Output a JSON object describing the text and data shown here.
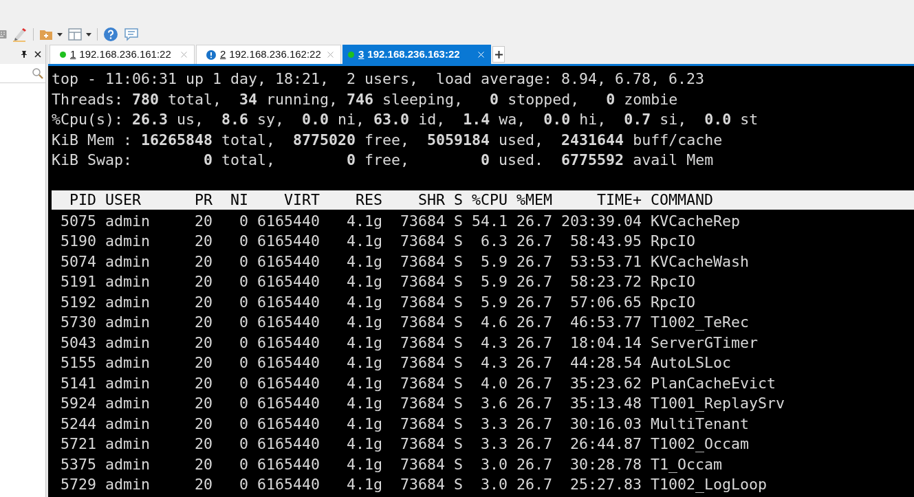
{
  "toolbar": {
    "items": [
      {
        "kind": "keyboard"
      },
      {
        "kind": "pen"
      },
      {
        "kind": "separator"
      },
      {
        "kind": "folder-add",
        "dropdown": true
      },
      {
        "kind": "layout",
        "dropdown": true
      },
      {
        "kind": "separator"
      },
      {
        "kind": "help"
      },
      {
        "kind": "chat"
      }
    ]
  },
  "tabs": [
    {
      "number": "1",
      "label": "192.168.236.161:22",
      "kind": "connected",
      "selected": false
    },
    {
      "number": "2",
      "label": "192.168.236.162:22",
      "kind": "warning",
      "selected": false
    },
    {
      "number": "3",
      "label": "192.168.236.163:22",
      "kind": "connected",
      "selected": true
    }
  ],
  "terminal": {
    "summary": [
      "top - 11:06:31 up 1 day, 18:21,  2 users,  load average: 8.94, 6.78, 6.23",
      "Threads: **780** total,  **34** running, **746** sleeping,   **0** stopped,   **0** zombie",
      "%Cpu(s): **26.3** us,  **8.6** sy,  **0.0** ni, **63.0** id,  **1.4** wa,  **0.0** hi,  **0.7** si,  **0.0** st",
      "KiB Mem : **16265848** total,  **8775020** free,  **5059184** used,  **2431644** buff/cache",
      "KiB Swap:        **0** total,        **0** free,        **0** used.  **6775592** avail Mem"
    ],
    "columns": [
      "PID",
      "USER",
      "PR",
      "NI",
      "VIRT",
      "RES",
      "SHR",
      "S",
      "%CPU",
      "%MEM",
      "TIME+",
      "COMMAND"
    ],
    "rows": [
      [
        "5075",
        "admin",
        "20",
        "0",
        "6165440",
        "4.1g",
        "73684",
        "S",
        "54.1",
        "26.7",
        "203:39.04",
        "KVCacheRep"
      ],
      [
        "5190",
        "admin",
        "20",
        "0",
        "6165440",
        "4.1g",
        "73684",
        "S",
        "6.3",
        "26.7",
        "58:43.95",
        "RpcIO"
      ],
      [
        "5074",
        "admin",
        "20",
        "0",
        "6165440",
        "4.1g",
        "73684",
        "S",
        "5.9",
        "26.7",
        "53:53.71",
        "KVCacheWash"
      ],
      [
        "5191",
        "admin",
        "20",
        "0",
        "6165440",
        "4.1g",
        "73684",
        "S",
        "5.9",
        "26.7",
        "58:23.72",
        "RpcIO"
      ],
      [
        "5192",
        "admin",
        "20",
        "0",
        "6165440",
        "4.1g",
        "73684",
        "S",
        "5.9",
        "26.7",
        "57:06.65",
        "RpcIO"
      ],
      [
        "5730",
        "admin",
        "20",
        "0",
        "6165440",
        "4.1g",
        "73684",
        "S",
        "4.6",
        "26.7",
        "46:53.77",
        "T1002_TeRec"
      ],
      [
        "5043",
        "admin",
        "20",
        "0",
        "6165440",
        "4.1g",
        "73684",
        "S",
        "4.3",
        "26.7",
        "18:04.14",
        "ServerGTimer"
      ],
      [
        "5155",
        "admin",
        "20",
        "0",
        "6165440",
        "4.1g",
        "73684",
        "S",
        "4.3",
        "26.7",
        "44:28.54",
        "AutoLSLoc"
      ],
      [
        "5141",
        "admin",
        "20",
        "0",
        "6165440",
        "4.1g",
        "73684",
        "S",
        "4.0",
        "26.7",
        "35:23.62",
        "PlanCacheEvict"
      ],
      [
        "5924",
        "admin",
        "20",
        "0",
        "6165440",
        "4.1g",
        "73684",
        "S",
        "3.6",
        "26.7",
        "35:13.48",
        "T1001_ReplaySrv"
      ],
      [
        "5244",
        "admin",
        "20",
        "0",
        "6165440",
        "4.1g",
        "73684",
        "S",
        "3.3",
        "26.7",
        "30:16.03",
        "MultiTenant"
      ],
      [
        "5721",
        "admin",
        "20",
        "0",
        "6165440",
        "4.1g",
        "73684",
        "S",
        "3.3",
        "26.7",
        "26:44.87",
        "T1002_Occam"
      ],
      [
        "5375",
        "admin",
        "20",
        "0",
        "6165440",
        "4.1g",
        "73684",
        "S",
        "3.0",
        "26.7",
        "30:28.78",
        "T1_Occam"
      ],
      [
        "5729",
        "admin",
        "20",
        "0",
        "6165440",
        "4.1g",
        "73684",
        "S",
        "3.0",
        "26.7",
        "25:27.83",
        "T1002_LogLoop"
      ]
    ]
  }
}
